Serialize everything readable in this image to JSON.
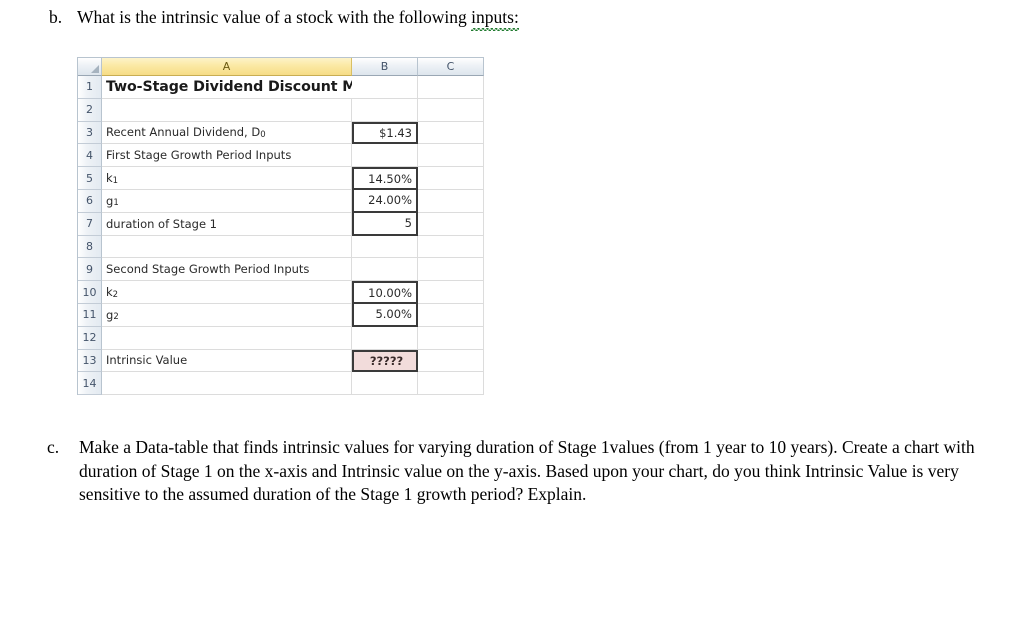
{
  "questions": [
    {
      "marker": "b.",
      "text_before": "What is the intrinsic value of a stock with the following ",
      "text_spellchecked": "inputs:",
      "text_after": ""
    },
    {
      "marker": "c.",
      "text": "Make a Data-table that finds intrinsic values for varying duration of Stage 1values (from 1 year to 10 years).  Create a chart with duration of Stage 1 on the x-axis and Intrinsic value on the y-axis.   Based upon your chart, do you think Intrinsic Value is very sensitive to the assumed duration of the Stage 1 growth period?  Explain."
    }
  ],
  "spreadsheet": {
    "column_headers": [
      "A",
      "B",
      "C"
    ],
    "selected_column": "A",
    "row_numbers": [
      "1",
      "2",
      "3",
      "4",
      "5",
      "6",
      "7",
      "8",
      "9",
      "10",
      "11",
      "12",
      "13",
      "14"
    ],
    "rows": [
      {
        "num": "1",
        "a_html": "Two-Stage Dividend Discount Model",
        "a_style": "title",
        "b": "",
        "c": ""
      },
      {
        "num": "2",
        "a_html": "",
        "a_style": "plain",
        "b": "",
        "c": ""
      },
      {
        "num": "3",
        "a_html": "Recent Annual Dividend, D<sub>0</sub>",
        "a_style": "plain",
        "b": "$1.43",
        "b_box": "single",
        "c": ""
      },
      {
        "num": "4",
        "a_html": "First Stage Growth Period Inputs",
        "a_style": "plain",
        "b": "",
        "c": ""
      },
      {
        "num": "5",
        "a_html": "k<sub>1</sub>",
        "a_style": "plain",
        "b": "14.50%",
        "b_box": "group-top",
        "c": ""
      },
      {
        "num": "6",
        "a_html": "g<sub>1</sub>",
        "a_style": "plain",
        "b": "24.00%",
        "b_box": "group-mid",
        "c": ""
      },
      {
        "num": "7",
        "a_html": "duration of Stage 1",
        "a_style": "plain",
        "b": "5",
        "b_box": "group-bottom",
        "c": ""
      },
      {
        "num": "8",
        "a_html": "",
        "a_style": "plain",
        "b": "",
        "c": ""
      },
      {
        "num": "9",
        "a_html": "Second Stage Growth Period Inputs",
        "a_style": "plain",
        "b": "",
        "c": ""
      },
      {
        "num": "10",
        "a_html": "k<sub>2</sub>",
        "a_style": "plain",
        "b": "10.00%",
        "b_box": "group-top",
        "c": ""
      },
      {
        "num": "11",
        "a_html": "g<sub>2</sub>",
        "a_style": "plain",
        "b": "5.00%",
        "b_box": "group-bottom",
        "c": ""
      },
      {
        "num": "12",
        "a_html": "",
        "a_style": "plain",
        "b": "",
        "c": ""
      },
      {
        "num": "13",
        "a_html": "Intrinsic Value",
        "a_style": "plain",
        "b": "?????",
        "b_box": "result",
        "c": ""
      },
      {
        "num": "14",
        "a_html": "",
        "a_style": "plain",
        "b": "",
        "c": ""
      }
    ]
  },
  "colors": {
    "selected_header": "#f6dc86",
    "header_gray": "#dde5ed",
    "result_cell": "#f2dcdb",
    "box_border": "#3a3a3a",
    "grid_line": "#dcdcdc",
    "spellcheck_underline": "#1f7a2e"
  }
}
